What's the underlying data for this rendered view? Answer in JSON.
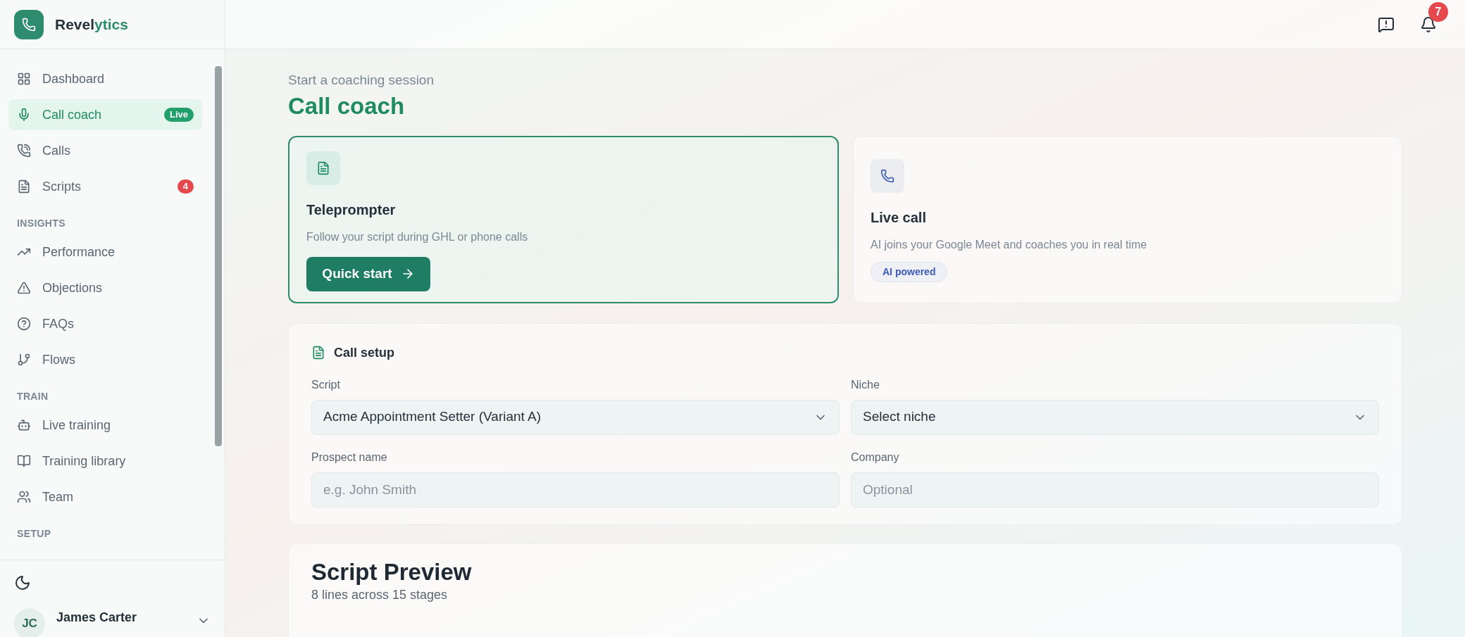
{
  "brand": {
    "name_start": "Revel",
    "name_end": "ytics"
  },
  "sidebar": {
    "sections": [
      {
        "items": [
          {
            "label": "Dashboard",
            "selected": false
          },
          {
            "label": "Call coach",
            "selected": true,
            "badge": "Live",
            "kind": "live"
          },
          {
            "label": "Calls",
            "selected": false
          },
          {
            "label": "Scripts",
            "selected": false,
            "badge": "4",
            "kind": "count"
          }
        ]
      },
      {
        "heading": "INSIGHTS",
        "items": [
          {
            "label": "Performance",
            "selected": false
          },
          {
            "label": "Objections",
            "selected": false
          },
          {
            "label": "FAQs",
            "selected": false
          },
          {
            "label": "Flows",
            "selected": false
          }
        ]
      },
      {
        "heading": "TRAIN",
        "items": [
          {
            "label": "Live training",
            "selected": false
          },
          {
            "label": "Training library",
            "selected": false
          },
          {
            "label": "Team",
            "selected": false
          }
        ]
      },
      {
        "heading": "SETUP"
      }
    ],
    "user": {
      "initials": "JC",
      "name": "James Carter"
    }
  },
  "header": {
    "notification_count": "7"
  },
  "page": {
    "subtitle": "Start a coaching session",
    "title": "Call coach"
  },
  "modes": [
    {
      "title": "Teleprompter",
      "description": "Follow your script during GHL or phone calls",
      "selected": true,
      "button": "Quick start"
    },
    {
      "title": "Live call",
      "description": "AI joins your Google Meet and coaches you in real time",
      "selected": false,
      "tag": "AI powered"
    }
  ],
  "call_setup": {
    "title": "Call setup",
    "fields": [
      {
        "label": "Script",
        "kind": "select",
        "value": "Acme Appointment Setter (Variant A)"
      },
      {
        "label": "Niche",
        "kind": "select",
        "value": "Select niche"
      },
      {
        "label": "Prospect name",
        "kind": "text",
        "placeholder": "e.g. John Smith"
      },
      {
        "label": "Company",
        "kind": "text",
        "placeholder": "Optional"
      }
    ]
  },
  "preview": {
    "title": "Script Preview",
    "summary": "8 lines across 15 stages"
  }
}
